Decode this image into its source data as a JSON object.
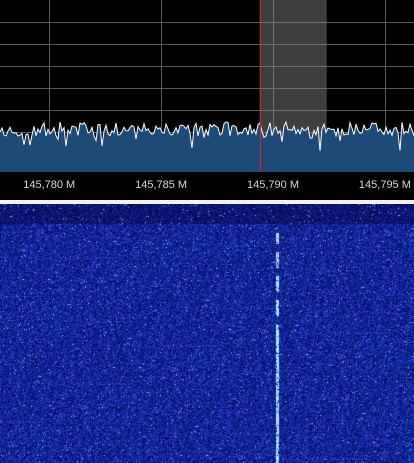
{
  "app": {
    "view": "spectrum-waterfall"
  },
  "frequency_axis": {
    "tick_labels": [
      "145,780 M",
      "145,785 M",
      "145,790 M",
      "145,795 M"
    ],
    "tick_values_mhz": [
      145.78,
      145.785,
      145.79,
      145.795
    ],
    "visible_range_mhz": [
      145.7778,
      145.7963
    ]
  },
  "tuning": {
    "center_mhz": 145.7894,
    "filter_band_mhz": [
      145.7894,
      145.7924
    ]
  },
  "signal": {
    "carrier_mhz": 145.7902
  },
  "colors": {
    "grid": "#5a5a5a",
    "trace": "#ffffff",
    "trace_fill": "#1e4a78",
    "tuning_line": "#e02020",
    "filter_band": "#8a8a8a",
    "waterfall_base": "#0a1a8c",
    "waterfall_hot": "#9ad8ff"
  }
}
